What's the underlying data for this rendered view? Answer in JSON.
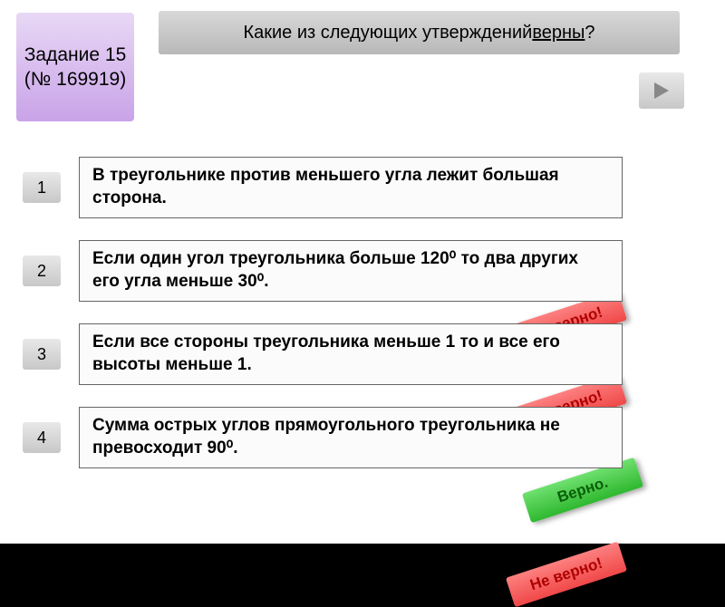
{
  "task_badge": "Задание 15\n(№ 169919)",
  "question_prefix": "Какие из следующих утверждений ",
  "question_keyword": "верны",
  "question_suffix": "?",
  "labels": {
    "wrong": "Не верно!",
    "correct": "Верно."
  },
  "statements": [
    {
      "num": "1",
      "text": "В треугольнике против меньшего угла лежит большая сторона.",
      "result": "wrong"
    },
    {
      "num": "2",
      "text": "Если один угол треугольника больше 120⁰ то два других его угла меньше 30⁰.",
      "result": "wrong"
    },
    {
      "num": "3",
      "text": "Если все стороны треугольника меньше 1 то и все его высоты меньше 1.",
      "result": "correct"
    },
    {
      "num": "4",
      "text": "Сумма острых углов прямоугольного треугольника не превосходит 90⁰.",
      "result": "wrong"
    }
  ]
}
